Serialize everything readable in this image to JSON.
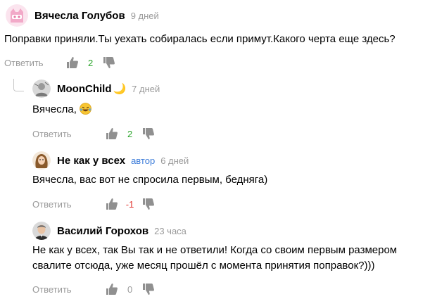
{
  "comments": [
    {
      "author": "Вячесла Голубов",
      "time": "9 дней",
      "text": "Поправки приняли.Ты уехать собиралась если примут.Какого черта еще здесь?",
      "reply_label": "Ответить",
      "rating": "2",
      "rating_color": "#2aa52a",
      "avatar_icon": "cat-mask-avatar"
    },
    {
      "author": "MoonChild",
      "author_emoji": "🌙",
      "time": "7 дней",
      "text": "Вячесла,",
      "text_emoji": "laughing-tears-emoji",
      "reply_label": "Ответить",
      "rating": "2",
      "rating_color": "#2aa52a",
      "avatar_icon": "sketch-photo-avatar"
    },
    {
      "author": "Не как у всех",
      "badge": "автор",
      "time": "6 дней",
      "text": "Вячесла, вас вот не спросила первым, бедняга)",
      "reply_label": "Ответить",
      "rating": "-1",
      "rating_color": "#e0302b",
      "avatar_icon": "woman-drawing-avatar"
    },
    {
      "author": "Василий Горохов",
      "time": "23 часа",
      "text_lines": [
        "Не как у всех, так Вы так и не ответили! Когда со своим первым размером",
        "свалите отсюда, уже месяц прошёл с момента принятия поправок?)))"
      ],
      "reply_label": "Ответить",
      "rating": "0",
      "rating_color": "#999999",
      "avatar_icon": "man-portrait-avatar"
    }
  ]
}
